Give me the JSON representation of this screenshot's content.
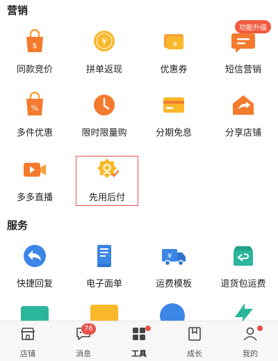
{
  "sections": {
    "marketing_title": "营销",
    "service_title": "服务"
  },
  "marketing": [
    {
      "label": "同款竞价",
      "icon": "shopping-bag-icon"
    },
    {
      "label": "拼单返现",
      "icon": "yuan-coin-icon"
    },
    {
      "label": "优惠券",
      "icon": "coupon-icon"
    },
    {
      "label": "短信营销",
      "icon": "sms-chat-icon",
      "badge": "功能升级"
    },
    {
      "label": "多件优惠",
      "icon": "percent-bag-icon"
    },
    {
      "label": "限时限量购",
      "icon": "clock-icon"
    },
    {
      "label": "分期免息",
      "icon": "credit-card-icon"
    },
    {
      "label": "分享店铺",
      "icon": "share-house-icon"
    },
    {
      "label": "多多直播",
      "icon": "video-camera-icon"
    },
    {
      "label": "先用后付",
      "icon": "badge-check-icon",
      "highlighted": true
    }
  ],
  "service": [
    {
      "label": "快捷回复",
      "icon": "reply-arrow-icon"
    },
    {
      "label": "电子面单",
      "icon": "e-waybill-icon"
    },
    {
      "label": "运费模板",
      "icon": "delivery-truck-icon"
    },
    {
      "label": "退货包运费",
      "icon": "return-box-icon"
    }
  ],
  "tabbar": {
    "items": [
      {
        "label": "店铺",
        "icon": "store-icon"
      },
      {
        "label": "消息",
        "icon": "message-icon",
        "count": "76"
      },
      {
        "label": "工具",
        "icon": "tools-grid-icon",
        "active": true,
        "dot": true
      },
      {
        "label": "成长",
        "icon": "bookmark-book-icon"
      },
      {
        "label": "我的",
        "icon": "user-icon",
        "dot": true
      }
    ]
  },
  "colors": {
    "orange": "#f47b2e",
    "orange_light": "#f9a23a",
    "yellow": "#f9b72a",
    "blue": "#3b86e6",
    "teal": "#2bb59a",
    "red_badge": "#e8504a"
  }
}
